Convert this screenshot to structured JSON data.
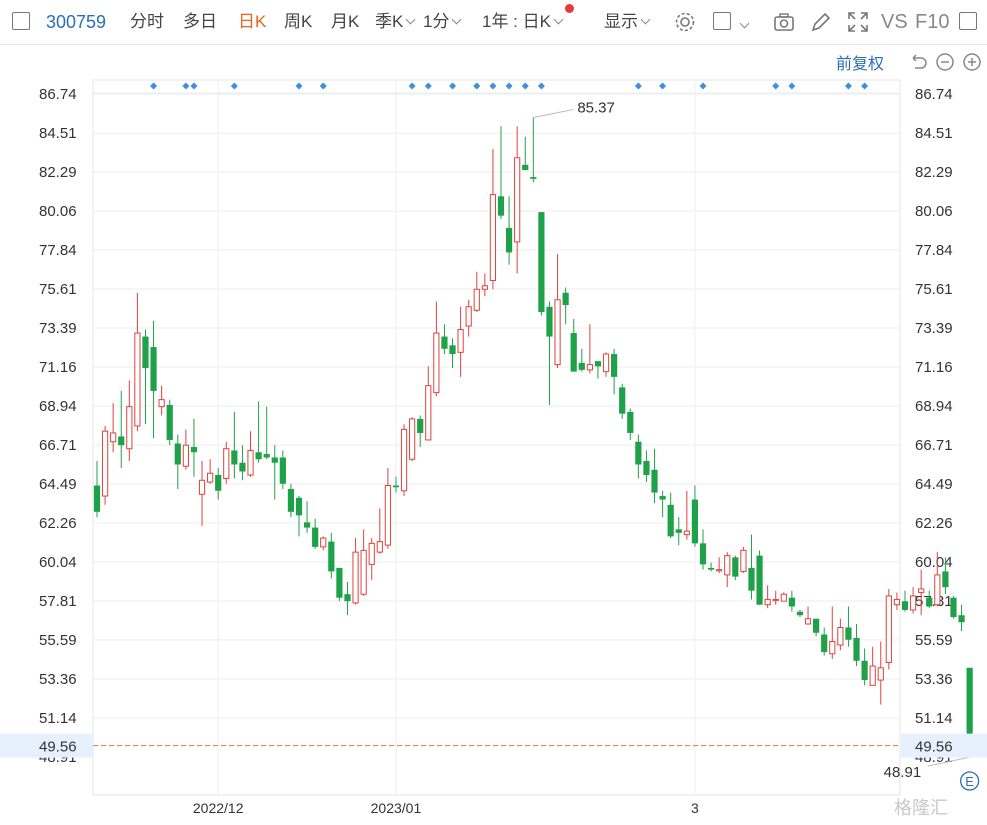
{
  "toolbar": {
    "code": "300759",
    "tabs": [
      "分时",
      "多日",
      "日K",
      "周K",
      "月K"
    ],
    "active_tab": "日K",
    "season_label": "季K",
    "minute_label": "1分",
    "range_label": "1年 : 日K",
    "display_label": "显示",
    "vs_label": "VS",
    "f10_label": "F10"
  },
  "adjust_label": "前复权",
  "watermark": "格隆汇",
  "event_marker": "E",
  "colors": {
    "up": "#e0423f",
    "down": "#1fa149",
    "accent": "#2a6fb7",
    "active": "#e8651a",
    "price_line": "#e8782e"
  },
  "chart_data": {
    "type": "candlestick",
    "y_ticks": [
      "86.74",
      "84.51",
      "82.29",
      "80.06",
      "77.84",
      "75.61",
      "73.39",
      "71.16",
      "68.94",
      "66.71",
      "64.49",
      "62.26",
      "60.04",
      "57.81",
      "55.59",
      "53.36",
      "51.14",
      "48.91"
    ],
    "ylim": [
      48.91,
      86.74
    ],
    "x_ticks": [
      {
        "label": "2022/12",
        "index": 15
      },
      {
        "label": "2023/01",
        "index": 37
      },
      {
        "label": "3",
        "index": 74
      }
    ],
    "current_price": "49.56",
    "max_label": "85.37",
    "min_label": "48.91",
    "marker_days": [
      7,
      11,
      12,
      17,
      25,
      28,
      39,
      41,
      44,
      47,
      49,
      51,
      53,
      55,
      67,
      70,
      75,
      84,
      86,
      93,
      95
    ],
    "candles": [
      [
        64.4,
        62.9,
        65.8,
        62.6
      ],
      [
        63.8,
        67.5,
        67.8,
        63.3
      ],
      [
        66.9,
        67.4,
        69.1,
        66.3
      ],
      [
        67.2,
        66.7,
        69.8,
        65.4
      ],
      [
        66.5,
        68.9,
        70.4,
        65.8
      ],
      [
        67.8,
        73.1,
        75.4,
        67.5
      ],
      [
        72.9,
        71.1,
        73.3,
        67.9
      ],
      [
        72.3,
        69.8,
        73.8,
        67.1
      ],
      [
        68.9,
        69.3,
        70.1,
        68.4
      ],
      [
        69.0,
        67.0,
        69.3,
        66.7
      ],
      [
        66.8,
        65.6,
        67.3,
        64.2
      ],
      [
        65.5,
        66.7,
        67.6,
        65.3
      ],
      [
        66.6,
        66.3,
        68.2,
        64.9
      ],
      [
        63.9,
        64.7,
        65.8,
        62.1
      ],
      [
        64.6,
        65.1,
        65.9,
        64.5
      ],
      [
        65.0,
        64.1,
        65.4,
        63.6
      ],
      [
        64.8,
        66.5,
        66.9,
        64.5
      ],
      [
        66.4,
        65.6,
        68.6,
        64.8
      ],
      [
        65.7,
        65.2,
        66.7,
        64.7
      ],
      [
        65.0,
        66.4,
        67.5,
        64.9
      ],
      [
        66.3,
        65.9,
        69.2,
        65.7
      ],
      [
        66.2,
        66.0,
        68.9,
        65.9
      ],
      [
        66.0,
        65.7,
        66.7,
        63.6
      ],
      [
        66.0,
        64.5,
        66.4,
        64.2
      ],
      [
        64.2,
        62.9,
        64.5,
        62.6
      ],
      [
        63.7,
        62.7,
        63.8,
        61.5
      ],
      [
        62.3,
        62.0,
        63.5,
        61.7
      ],
      [
        62.0,
        60.9,
        62.5,
        60.8
      ],
      [
        60.9,
        61.4,
        61.5,
        60.7
      ],
      [
        61.2,
        59.5,
        61.7,
        59.1
      ],
      [
        59.7,
        58.0,
        59.7,
        57.8
      ],
      [
        58.2,
        57.8,
        58.9,
        57.0
      ],
      [
        57.7,
        60.6,
        61.4,
        57.6
      ],
      [
        58.2,
        60.7,
        61.9,
        58.1
      ],
      [
        59.9,
        61.1,
        61.4,
        59.0
      ],
      [
        60.6,
        61.2,
        63.1,
        60.5
      ],
      [
        61.0,
        64.4,
        65.4,
        60.8
      ],
      [
        64.4,
        64.3,
        64.9,
        64.0
      ],
      [
        64.1,
        67.6,
        67.9,
        63.8
      ],
      [
        65.9,
        68.2,
        68.3,
        65.8
      ],
      [
        68.2,
        67.4,
        68.4,
        66.6
      ],
      [
        67.0,
        70.1,
        71.2,
        67.0
      ],
      [
        69.7,
        73.1,
        74.9,
        69.5
      ],
      [
        72.9,
        72.2,
        73.6,
        71.9
      ],
      [
        72.4,
        71.9,
        72.8,
        71.1
      ],
      [
        72.0,
        73.3,
        74.6,
        70.6
      ],
      [
        73.5,
        74.6,
        75.0,
        72.9
      ],
      [
        74.4,
        75.6,
        76.6,
        74.3
      ],
      [
        75.6,
        75.8,
        76.5,
        75.2
      ],
      [
        76.1,
        81.0,
        83.6,
        75.6
      ],
      [
        80.9,
        79.8,
        84.9,
        79.6
      ],
      [
        79.1,
        77.7,
        80.9,
        77.0
      ],
      [
        78.3,
        83.1,
        84.9,
        76.5
      ],
      [
        82.7,
        82.4,
        84.3,
        82.4
      ],
      [
        82.0,
        81.9,
        85.4,
        81.7
      ],
      [
        80.0,
        74.3,
        80.0,
        74.1
      ],
      [
        74.6,
        72.9,
        74.9,
        69.0
      ],
      [
        71.3,
        75.0,
        77.6,
        71.1
      ],
      [
        75.4,
        74.7,
        75.7,
        73.6
      ],
      [
        73.1,
        70.9,
        73.9,
        70.9
      ],
      [
        71.4,
        71.0,
        72.2,
        70.9
      ],
      [
        71.0,
        71.3,
        73.6,
        70.8
      ],
      [
        71.5,
        71.2,
        71.3,
        70.5
      ],
      [
        70.9,
        71.9,
        72.0,
        70.6
      ],
      [
        71.9,
        70.6,
        72.2,
        69.6
      ],
      [
        70.0,
        68.5,
        70.2,
        68.2
      ],
      [
        68.6,
        67.4,
        68.8,
        67.0
      ],
      [
        66.9,
        65.6,
        67.3,
        64.8
      ],
      [
        65.8,
        65.0,
        66.4,
        64.6
      ],
      [
        65.3,
        64.0,
        66.5,
        63.4
      ],
      [
        63.8,
        63.6,
        64.1,
        62.6
      ],
      [
        63.3,
        61.5,
        64.0,
        61.4
      ],
      [
        61.9,
        61.7,
        62.6,
        61.0
      ],
      [
        61.6,
        61.8,
        64.1,
        61.3
      ],
      [
        63.6,
        61.1,
        64.4,
        60.9
      ],
      [
        61.1,
        59.9,
        61.9,
        59.6
      ],
      [
        59.7,
        59.6,
        60.0,
        59.5
      ],
      [
        59.6,
        59.6,
        60.3,
        59.4
      ],
      [
        59.3,
        60.4,
        60.6,
        58.6
      ],
      [
        60.3,
        59.2,
        60.4,
        59.0
      ],
      [
        59.5,
        60.7,
        60.9,
        59.4
      ],
      [
        59.7,
        58.4,
        61.6,
        57.9
      ],
      [
        60.4,
        57.6,
        60.7,
        57.6
      ],
      [
        57.6,
        57.9,
        58.7,
        57.4
      ],
      [
        57.9,
        57.9,
        58.4,
        57.6
      ],
      [
        57.8,
        58.2,
        58.3,
        57.8
      ],
      [
        58.0,
        57.5,
        58.4,
        57.2
      ],
      [
        57.2,
        57.0,
        57.3,
        56.9
      ],
      [
        56.5,
        56.8,
        57.5,
        56.6
      ],
      [
        56.8,
        56.0,
        56.8,
        55.8
      ],
      [
        55.9,
        54.9,
        56.3,
        54.7
      ],
      [
        54.8,
        55.5,
        57.5,
        54.5
      ],
      [
        55.3,
        56.3,
        56.8,
        55.0
      ],
      [
        56.3,
        55.6,
        57.5,
        55.2
      ],
      [
        55.7,
        54.4,
        56.5,
        54.1
      ],
      [
        54.4,
        53.3,
        55.1,
        53.0
      ],
      [
        53.0,
        54.1,
        55.2,
        53.4
      ],
      [
        53.3,
        54.0,
        55.5,
        51.9
      ],
      [
        54.3,
        58.1,
        58.5,
        53.9
      ],
      [
        57.6,
        57.9,
        58.3,
        57.3
      ],
      [
        57.8,
        57.3,
        58.4,
        57.2
      ],
      [
        57.3,
        58.1,
        58.6,
        57.1
      ],
      [
        58.3,
        58.5,
        59.6,
        57.0
      ],
      [
        58.0,
        57.5,
        58.4,
        57.4
      ],
      [
        57.6,
        59.3,
        60.6,
        57.5
      ],
      [
        59.5,
        58.6,
        60.3,
        58.2
      ],
      [
        58.0,
        56.9,
        58.1,
        56.8
      ],
      [
        57.0,
        56.6,
        57.6,
        56.1
      ],
      [
        54.0,
        49.6,
        54.0,
        48.9
      ]
    ]
  }
}
